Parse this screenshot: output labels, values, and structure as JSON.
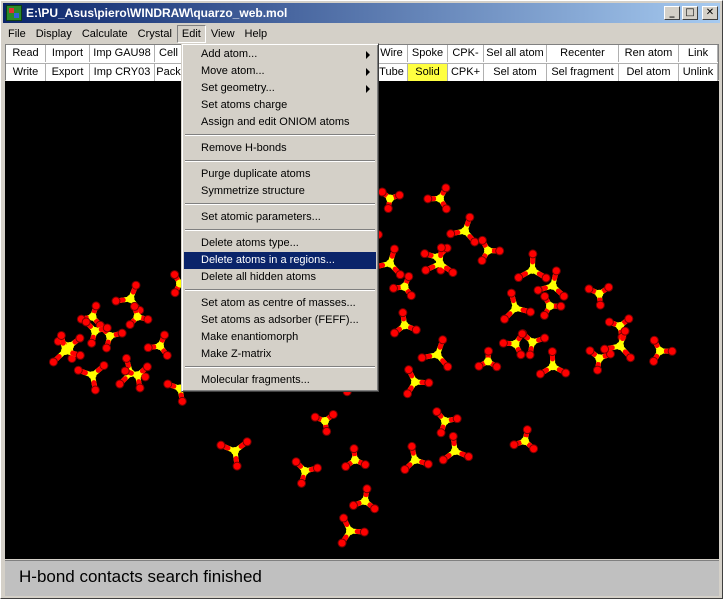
{
  "window": {
    "title": "E:\\PU_Asus\\piero\\WINDRAW\\quarzo_web.mol",
    "minimize": "_",
    "maximize": "□",
    "close": "✕"
  },
  "menubar": [
    "File",
    "Display",
    "Calculate",
    "Crystal",
    "Edit",
    "View",
    "Help"
  ],
  "toolbar": {
    "row1": [
      "Read",
      "Import",
      "Imp GAU98",
      "Cell",
      "Wire",
      "Spoke",
      "CPK-",
      "Sel all atom",
      "Recenter",
      "Ren atom",
      "Link"
    ],
    "row2": [
      "Write",
      "Export",
      "Imp CRY03",
      "Pack",
      "Tube",
      "Solid",
      "CPK+",
      "Sel atom",
      "Sel fragment",
      "Del atom",
      "Unlink"
    ],
    "highlight_color": "#ffff40"
  },
  "edit_menu": {
    "groups": [
      [
        {
          "label": "Add atom...",
          "submenu": true
        },
        {
          "label": "Move atom...",
          "submenu": true
        },
        {
          "label": "Set geometry...",
          "submenu": true
        },
        {
          "label": "Set atoms charge",
          "submenu": false
        },
        {
          "label": "Assign and edit ONIOM atoms",
          "submenu": false
        }
      ],
      [
        {
          "label": "Remove H-bonds",
          "submenu": false
        }
      ],
      [
        {
          "label": "Purge duplicate atoms",
          "submenu": false
        },
        {
          "label": "Symmetrize structure",
          "submenu": false
        }
      ],
      [
        {
          "label": "Set atomic parameters...",
          "submenu": false
        }
      ],
      [
        {
          "label": "Delete atoms type...",
          "submenu": false
        },
        {
          "label": "Delete atoms in a regions...",
          "submenu": false,
          "selected": true
        },
        {
          "label": "Delete all hidden atoms",
          "submenu": false
        }
      ],
      [
        {
          "label": "Set atom as centre of masses...",
          "submenu": false
        },
        {
          "label": "Set atoms as adsorber (FEFF)...",
          "submenu": false
        },
        {
          "label": "Make enantiomorph",
          "submenu": false
        },
        {
          "label": "Make Z-matrix",
          "submenu": false
        }
      ],
      [
        {
          "label": "Molecular fragments...",
          "submenu": false
        }
      ]
    ]
  },
  "viewport": {
    "background": "#000000",
    "atom_color_oxygen": "#ff0000",
    "atom_color_silicon": "#ffff00"
  },
  "status": {
    "text": "H-bond contacts search finished"
  }
}
